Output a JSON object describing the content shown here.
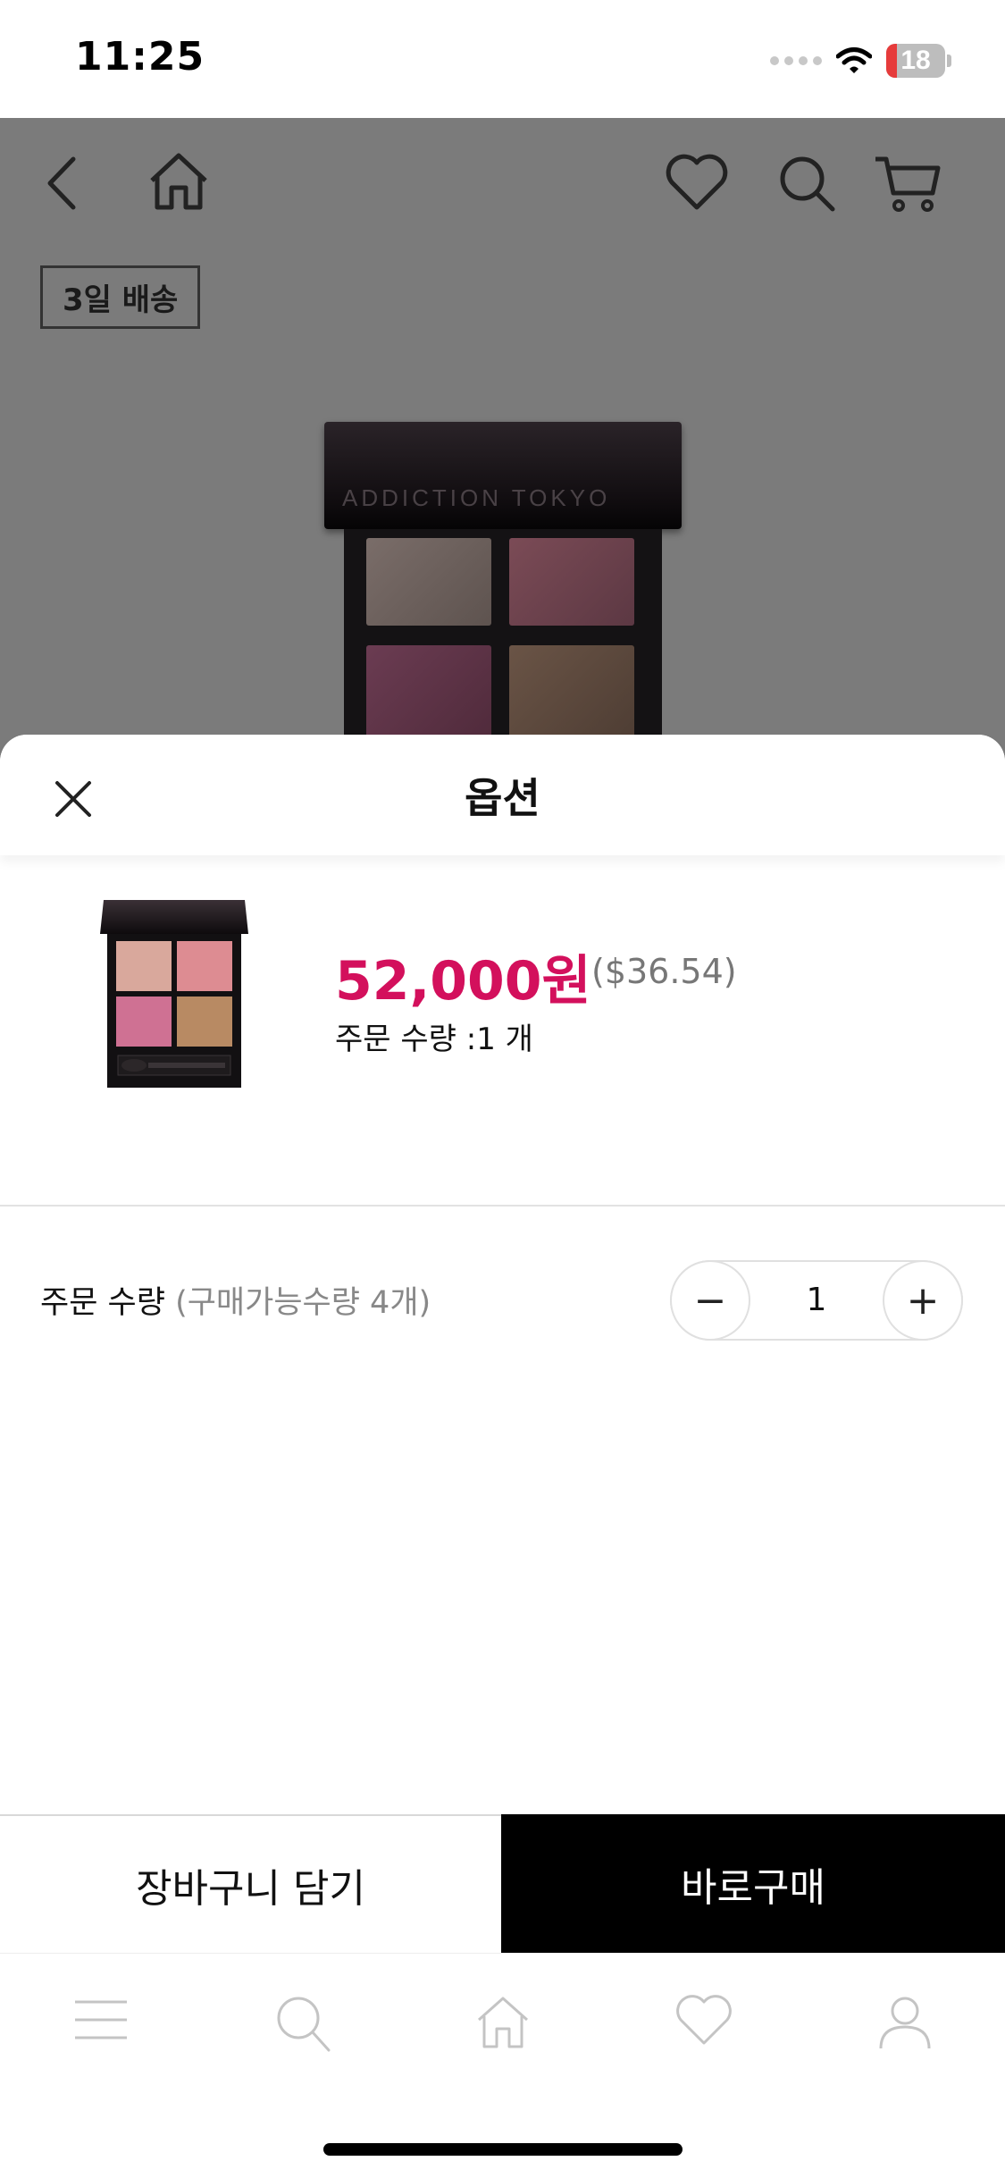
{
  "status_bar": {
    "time": "11:25",
    "battery_level": "18",
    "battery_fraction": 0.18
  },
  "background_page": {
    "delivery_tag": "3일 배송",
    "product_brand_text": "ADDICTION TOKYO",
    "icons": [
      "back-icon",
      "home-icon",
      "heart-icon",
      "search-icon",
      "cart-icon"
    ]
  },
  "sheet": {
    "title": "옵션",
    "product": {
      "price": "52,000원",
      "price_usd": "($36.54)",
      "order_qty_line": "주문 수량 :1 개"
    },
    "quantity": {
      "label": "주문 수량",
      "available": "(구매가능수량 4개)",
      "value": "1",
      "minus": "−",
      "plus": "+"
    }
  },
  "actions": {
    "add_to_cart": "장바구니 담기",
    "buy_now": "바로구매"
  },
  "tabbar": {
    "items": [
      "menu-icon",
      "search-icon",
      "home-icon",
      "heart-icon",
      "person-icon"
    ]
  },
  "colors": {
    "price": "#d3105c",
    "buy_button": "#000000",
    "backdrop": "#7b7b7b"
  }
}
